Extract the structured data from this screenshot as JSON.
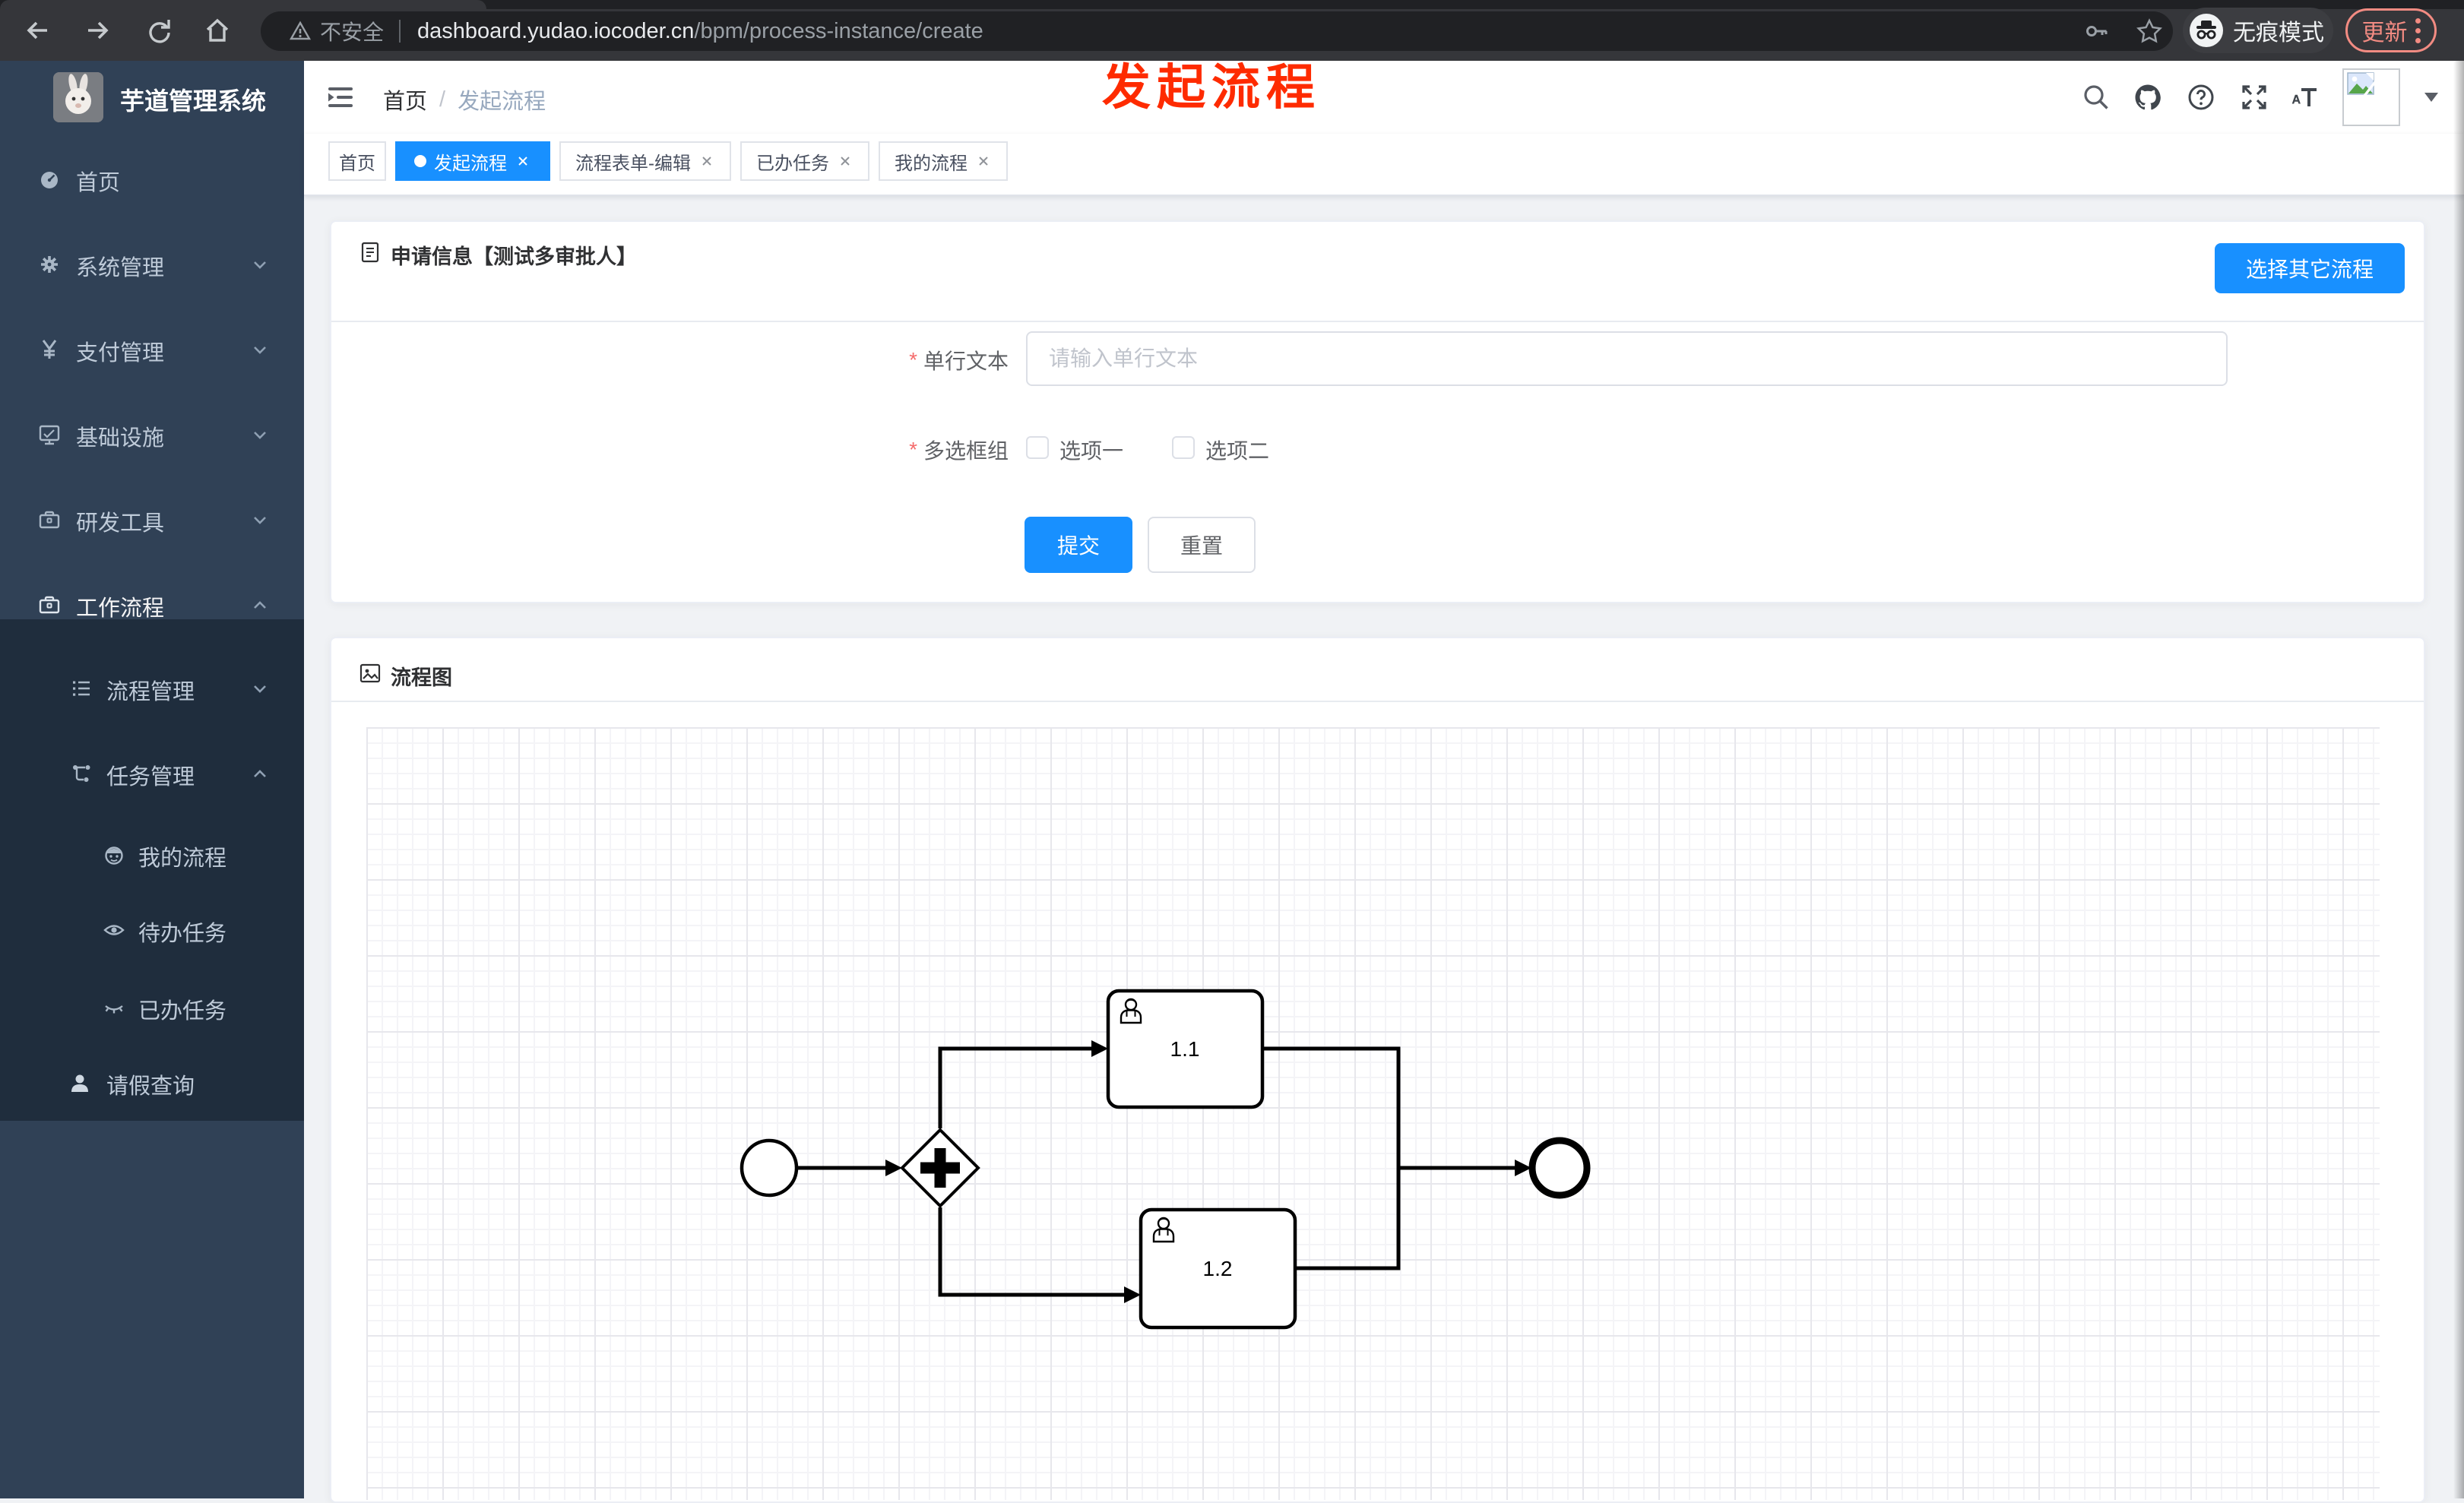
{
  "colors": {
    "primary": "#1890ff",
    "sidebar_bg": "#304156",
    "submenu_bg": "#1f2d3d",
    "annotation_red": "#fe2b00",
    "chrome_accent": "#f28b82"
  },
  "browser": {
    "security": "不安全",
    "host": "dashboard.yudao.iocoder.cn",
    "path": "/bpm/process-instance/create",
    "incognito": "无痕模式",
    "update": "更新"
  },
  "sidebar": {
    "title": "芋道管理系统",
    "items": [
      {
        "label": "首页"
      },
      {
        "label": "系统管理"
      },
      {
        "label": "支付管理"
      },
      {
        "label": "基础设施"
      },
      {
        "label": "研发工具"
      },
      {
        "label": "工作流程"
      },
      {
        "label": "流程管理"
      },
      {
        "label": "任务管理"
      },
      {
        "label": "我的流程"
      },
      {
        "label": "待办任务"
      },
      {
        "label": "已办任务"
      },
      {
        "label": "请假查询"
      }
    ]
  },
  "header": {
    "breadcrumb": [
      "首页",
      "发起流程"
    ],
    "annotation": "发起流程"
  },
  "tabs": [
    {
      "label": "首页"
    },
    {
      "label": "发起流程"
    },
    {
      "label": "流程表单-编辑"
    },
    {
      "label": "已办任务"
    },
    {
      "label": "我的流程"
    }
  ],
  "apply_card": {
    "title": "申请信息【测试多审批人】",
    "select_other": "选择其它流程",
    "text_label": "单行文本",
    "text_placeholder": "请输入单行文本",
    "checkbox_label": "多选框组",
    "options": [
      "选项一",
      "选项二"
    ],
    "submit": "提交",
    "reset": "重置"
  },
  "diagram_card": {
    "title": "流程图",
    "tasks": [
      {
        "label": "1.1"
      },
      {
        "label": "1.2"
      }
    ]
  }
}
